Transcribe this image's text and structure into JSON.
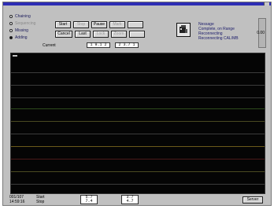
{
  "toolbar": {
    "modes": [
      {
        "label": "Chaining",
        "selected": false,
        "dim": false
      },
      {
        "label": "Sequencing",
        "selected": false,
        "dim": true
      },
      {
        "label": "Missing",
        "selected": false,
        "dim": false
      },
      {
        "label": "Adding",
        "selected": true,
        "dim": false
      }
    ],
    "buttons_row1": [
      {
        "label": "Start",
        "disabled": false
      },
      {
        "label": "Stop",
        "disabled": true
      },
      {
        "label": "Pause",
        "disabled": false
      },
      {
        "label": "Mark",
        "disabled": true
      }
    ],
    "buttons_row2": [
      {
        "label": "Cancel",
        "disabled": false
      },
      {
        "label": "Last",
        "disabled": false
      },
      {
        "label": "Lock",
        "disabled": true
      },
      {
        "label": "Zoom",
        "disabled": true
      }
    ],
    "current_label": "Current",
    "fields": [
      "1 9.1 2",
      "2 3.7 1"
    ]
  },
  "info": {
    "lines": [
      "Nessage",
      "Complete, on Range",
      "Reconnecting",
      "Reconnecting CAL/MB"
    ]
  },
  "right_mark": "0.00",
  "status": {
    "left_lines": [
      "001/107",
      "14:59:16"
    ],
    "center_lines": [
      "Start",
      "Stop"
    ],
    "field1": [
      "5.7",
      "7.4"
    ],
    "field2": [
      "3.7",
      "4.7"
    ],
    "button_label": "Server"
  },
  "colors": {
    "window_bg": "#c0c0c0",
    "display_bg": "#050505",
    "trace_gray": "#3c3c3c",
    "trace_green": "#2e4a1c",
    "trace_olive": "#4a4a22",
    "trace_amber": "#6b5a1a",
    "trace_red": "#4a1a1a"
  }
}
